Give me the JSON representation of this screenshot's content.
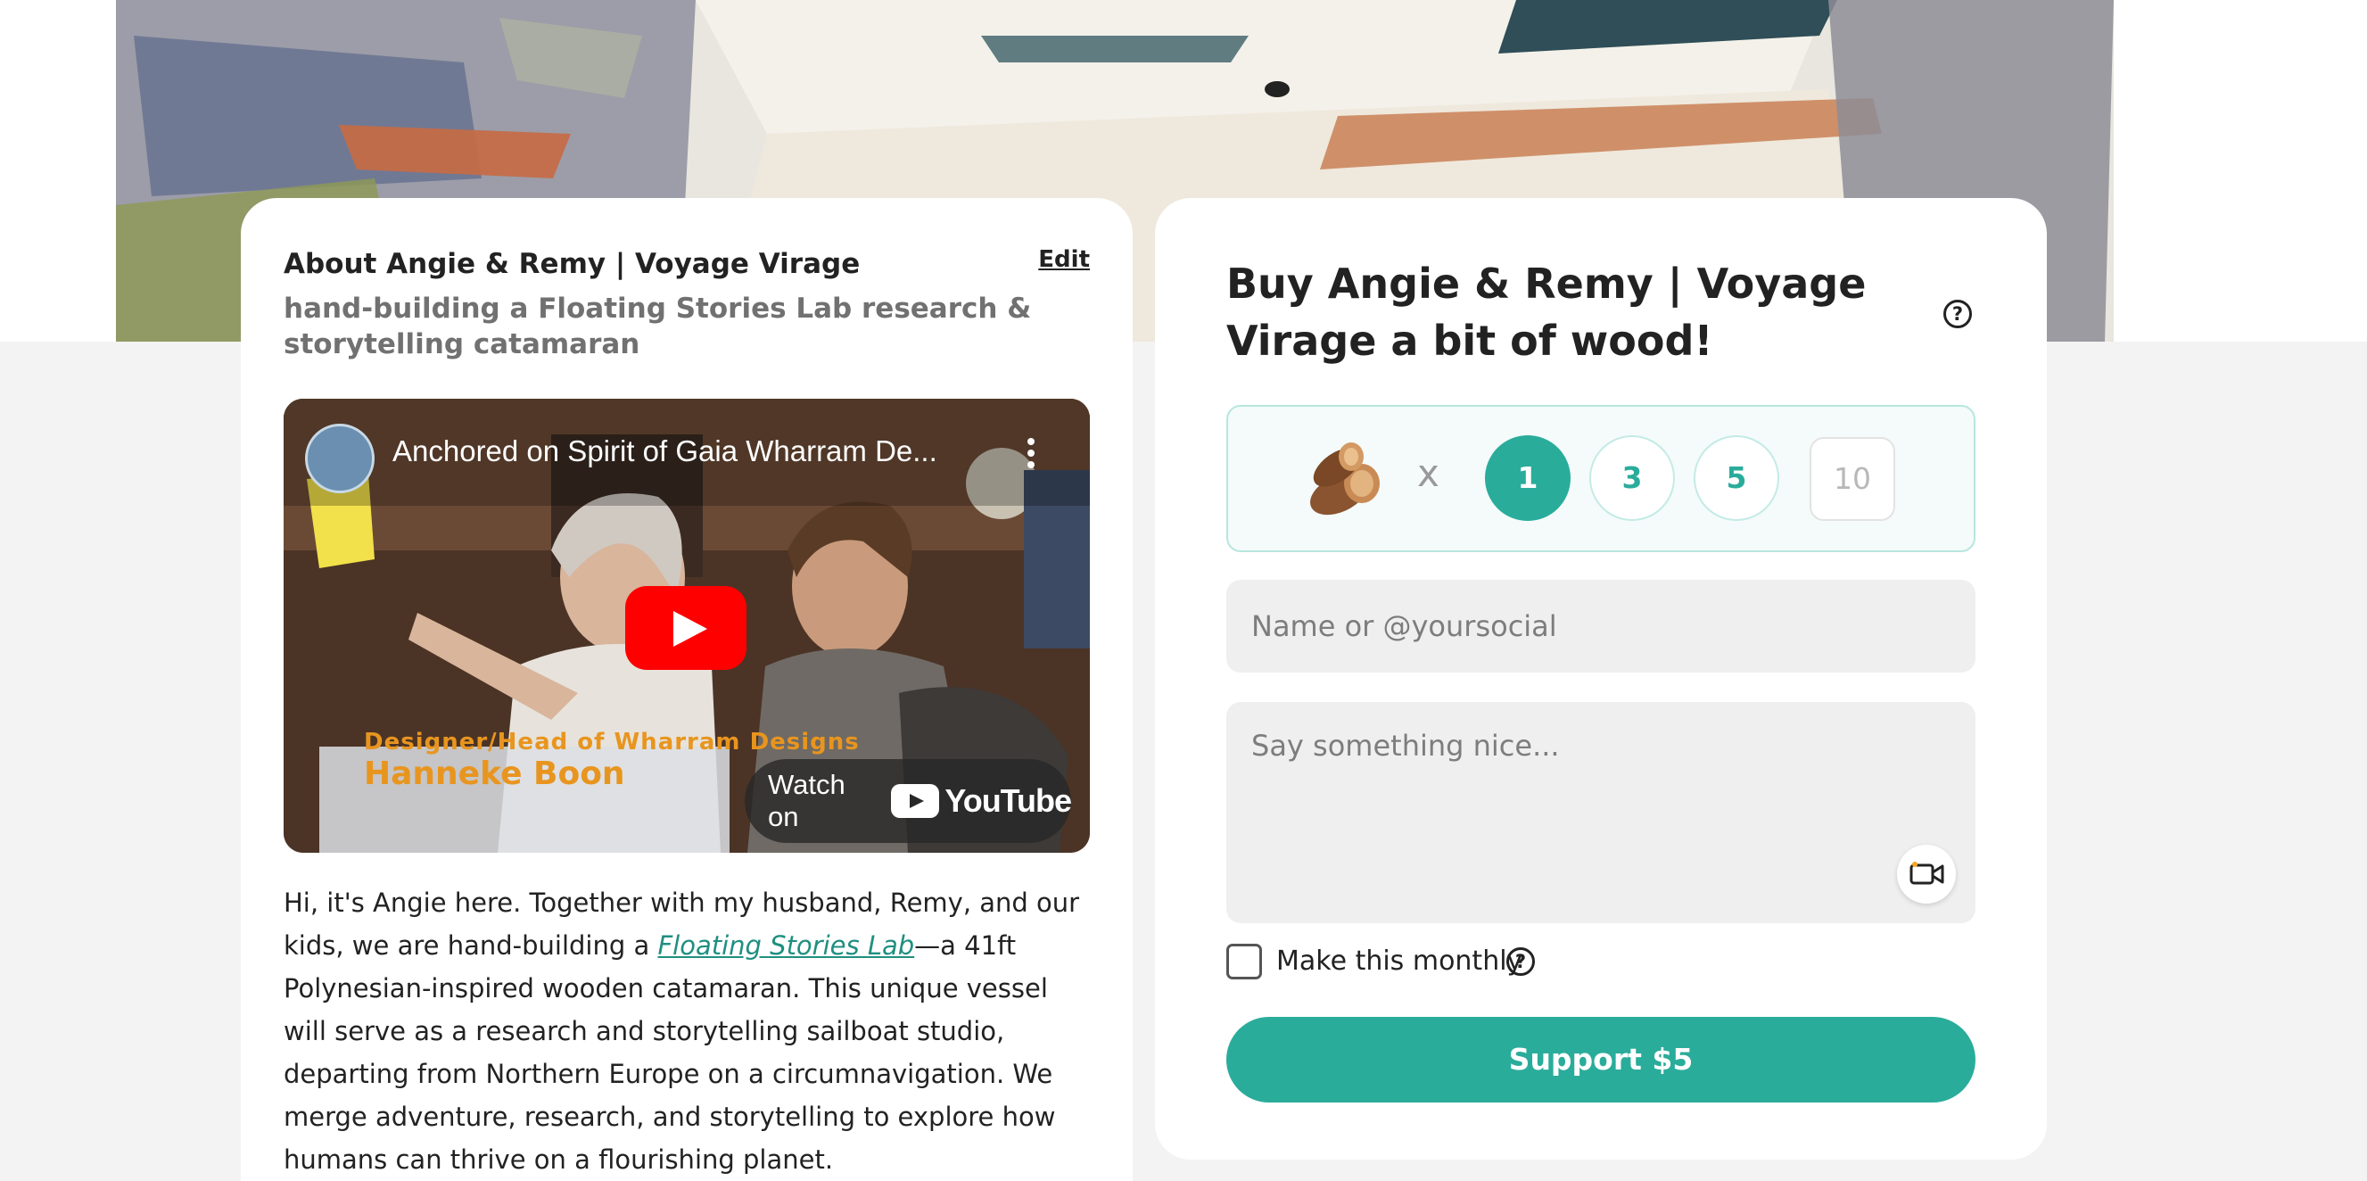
{
  "about": {
    "title": "About Angie & Remy | Voyage Virage",
    "edit_label": "Edit",
    "subtitle": "hand-building a Floating Stories Lab research & storytelling catamaran",
    "body_before_link": "Hi, it's Angie here. Together with my husband, Remy, and our kids, we are hand-building a ",
    "body_link": "Floating Stories Lab",
    "body_after_link": "—a 41ft Polynesian-inspired wooden catamaran. This unique vessel will serve as a research and storytelling sailboat studio, departing from Northern Europe on a circumnavigation. We merge adventure, research, and storytelling to explore how humans can thrive on a flourishing planet."
  },
  "video": {
    "title": "Anchored on Spirit of Gaia Wharram De...",
    "caption_role": "Designer/Head of Wharram Designs",
    "caption_name": "Hanneke Boon",
    "watch_on_label": "Watch on",
    "youtube_label": "YouTube"
  },
  "support": {
    "title": "Buy Angie & Remy | Voyage Virage a bit of wood!",
    "help_symbol": "?",
    "times_symbol": "x",
    "quantities": [
      "1",
      "3",
      "5"
    ],
    "selected_quantity": "1",
    "custom_quantity_placeholder": "10",
    "name_placeholder": "Name or @yoursocial",
    "message_placeholder": "Say something nice...",
    "monthly_label": "Make this monthly",
    "monthly_checked": false,
    "button_label": "Support $5"
  },
  "colors": {
    "accent": "#2aac9b",
    "youtube_red": "#ff0000",
    "caption_orange": "#e8951f"
  }
}
